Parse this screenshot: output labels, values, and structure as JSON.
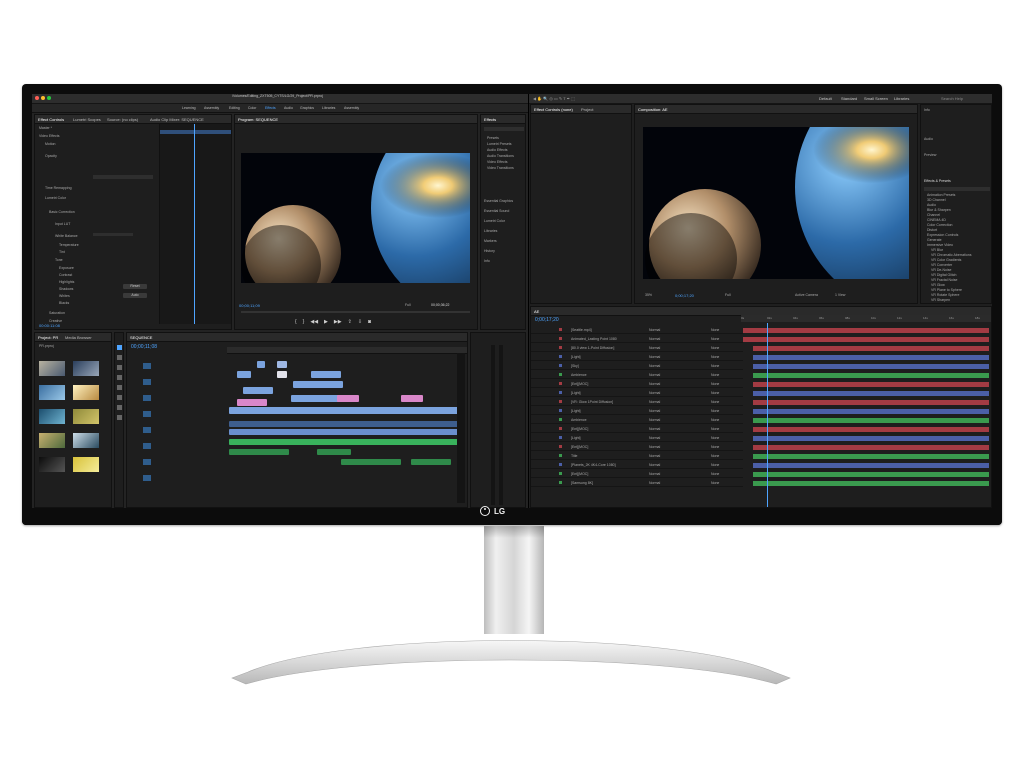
{
  "brand": {
    "logo_text": "LG"
  },
  "premiere": {
    "title": "/Volumes/Editing_ZXT505_CYTS/LG/29_Project/PR.prproj",
    "workspaces": [
      "Learning",
      "Assembly",
      "Editing",
      "Color",
      "Effects",
      "Audio",
      "Graphics",
      "Libraries",
      "Assembly"
    ],
    "effect_controls": {
      "tabs": [
        "Effect Controls",
        "Lumetri Scopes",
        "Source: (no clips)",
        "Audio Clip Mixer: SEQUENCE"
      ],
      "rows": [
        "Master *",
        "Video Effects",
        "Motion",
        "Opacity",
        "Time Remapping",
        "Lumetri Color",
        "Basic Correction",
        "Input LUT",
        "White Balance",
        "Temperature",
        "Tint",
        "Tone",
        "Exposure",
        "Contrast",
        "Highlights",
        "Shadows",
        "Whites",
        "Blacks",
        "Saturation",
        "Creative"
      ],
      "buttons": [
        "Reset",
        "Auto"
      ],
      "timecode": "00:00:11:08"
    },
    "program": {
      "tab": "Program: SEQUENCE",
      "timecode_left": "00;00;11;09",
      "fit": "Full",
      "timecode_right": "00;00;36;22"
    },
    "effects_panel": {
      "tab": "Effects",
      "items": [
        "Presets",
        "Lumetri Presets",
        "Audio Effects",
        "Audio Transitions",
        "Video Effects",
        "Video Transitions",
        "Essential Graphics",
        "Essential Sound",
        "Lumetri Color",
        "Libraries",
        "Markers",
        "History",
        "Info"
      ]
    },
    "project": {
      "tabs": [
        "Project: PR",
        "Media Browser"
      ],
      "name": "PR.prproj"
    },
    "timeline": {
      "tab": "SEQUENCE",
      "timecode": "00;00;11;08"
    }
  },
  "after_effects": {
    "workspaces": [
      "Default",
      "Standard",
      "Small Screen",
      "Libraries"
    ],
    "search_placeholder": "Search Help",
    "effect_controls_tab": "Effect Controls (none)",
    "project_tab": "Project",
    "composition_tab": "Composition: AE",
    "zoom": "35%",
    "timecode": "0;00;17;20",
    "quality": "Full",
    "active_camera": "Active Camera",
    "view": "1 View",
    "right_panels": [
      "Info",
      "Audio",
      "Preview",
      "Effects & Presets"
    ],
    "effects_presets": [
      "Animation Presets",
      "3D Channel",
      "Audio",
      "Blur & Sharpen",
      "Channel",
      "CINEMA 4D",
      "Color Correction",
      "Distort",
      "Expression Controls",
      "Generate",
      "Immersive Video",
      "VR Blur",
      "VR Chromatic Aberrations",
      "VR Color Gradients",
      "VR Converter",
      "VR De-Noise",
      "VR Digital Glitch",
      "VR Fractal Noise",
      "VR Glow",
      "VR Plane to Sphere",
      "VR Rotate Sphere",
      "VR Sharpen"
    ],
    "timeline": {
      "tab": "AE",
      "timecode": "0;00;17;20",
      "layer_names": [
        "[Seattle.mp4]",
        "Animated_Lasting Point 1080",
        "[80.0 view 1-Point Diffusion]",
        "[Light]",
        "[Sky]",
        "Ambience",
        "[Ent][MOC]",
        "[Light]",
        "[VR: Glow 1Point Diffusion]",
        "[Light]",
        "Ambience",
        "[Ent][MOC]",
        "[Light]",
        "[Ent][MOC]",
        "Title",
        "[Planets_2K 4K4-Core 1080]",
        "[Ent][MOC]",
        "[Samsung 8K]"
      ],
      "modes": [
        "Normal",
        "Normal",
        "Normal",
        "Normal",
        "Normal",
        "Normal",
        "Normal",
        "Normal",
        "Normal",
        "Normal",
        "Normal",
        "Normal",
        "Normal",
        "Normal",
        "Normal",
        "Normal",
        "Normal",
        "Normal"
      ],
      "parents": [
        "None",
        "None",
        "None",
        "None",
        "None",
        "None",
        "None",
        "None",
        "None",
        "None",
        "None",
        "None",
        "None",
        "None",
        "None",
        "None",
        "None",
        "None"
      ],
      "ruler": [
        "0s",
        "02s",
        "04s",
        "06s",
        "08s",
        "10s",
        "12s",
        "14s",
        "16s",
        "18s"
      ]
    }
  },
  "colors": {
    "accent_blue": "#4ea4ff",
    "clip_blue": "#7ba3de",
    "clip_pink": "#d987c9",
    "clip_green": "#39b25c",
    "ae_red": "#a33b43",
    "ae_green": "#3a9a4e",
    "ae_blue": "#4b5fa8"
  }
}
